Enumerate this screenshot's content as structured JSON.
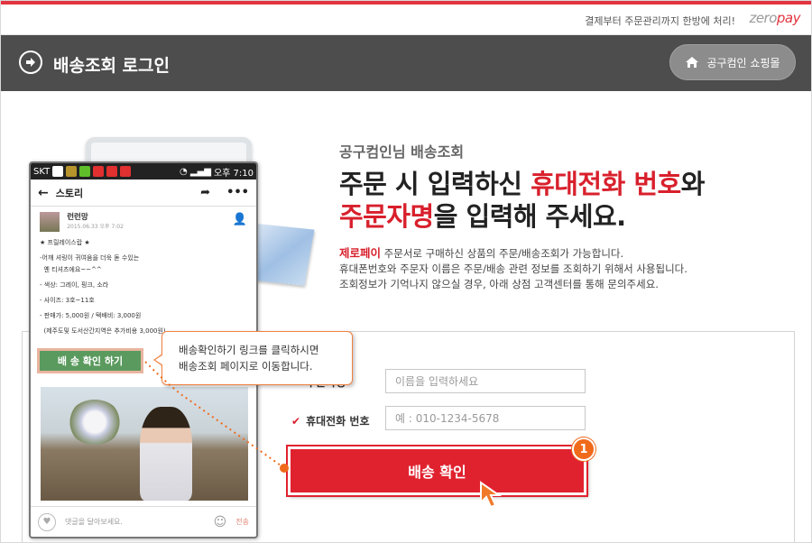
{
  "topbar": {
    "slogan": "결제부터 주문관리까지 한방에 처리!",
    "brand_a": "zero",
    "brand_b": "pay"
  },
  "header": {
    "title": "배송조회 로그인",
    "shop_button": "공구컴인 쇼핑몰"
  },
  "intro": {
    "subtitle": "공구컴인님 배송조회",
    "line1_a": "주문 시 입력하신 ",
    "line1_b": "휴대전화 번호",
    "line1_c": "와",
    "line2_a": "주문자명",
    "line2_b": "을 입력해 주세요.",
    "desc_brand": "제로페이",
    "desc1": " 주문서로 구매하신 상품의 주문/배송조회가 가능합니다.",
    "desc2": "휴대폰번호와 주문자 이름은 주문/배송 관련 정보를 조회하기 위해서 사용됩니다.",
    "desc3": "조회정보가 기억나지 않으실 경우, 아래 상점 고객센터를 통해 문의주세요."
  },
  "form": {
    "name_label": "주문자명",
    "name_placeholder": "이름을 입력하세요",
    "phone_label": "휴대전화 번호",
    "phone_placeholder": "예 : 010-1234-5678",
    "submit": "배송 확인",
    "step_badge": "1"
  },
  "phone": {
    "carrier": "SKT",
    "time": "오후 7:10",
    "app_title": "스토리",
    "post_name": "런런망",
    "post_date": "2015.06.33 오후 7:02",
    "post_lines": [
      "★ 프릴레이스랍 ★",
      "-어깨 셔링이 귀여움을 더욱 돋 수있는",
      "  옌 티셔츠에요~~^^",
      "- 색상: 그레이, 핑크, 소라",
      "- 사이즈: 3호~11호",
      "- 판매가: 5,000원 / 택배비: 3,000원",
      "  (제주도및 도서산간지역은 추가비용 3,000원)"
    ],
    "ship_check_button": "배 송 확인 하기",
    "comment_placeholder": "댓글을 달아보세요.",
    "send": "전송"
  },
  "tooltip": {
    "line1": "배송확인하기 링크를 클릭하시면",
    "line2": "배송조회 페이지로 이동합니다."
  }
}
